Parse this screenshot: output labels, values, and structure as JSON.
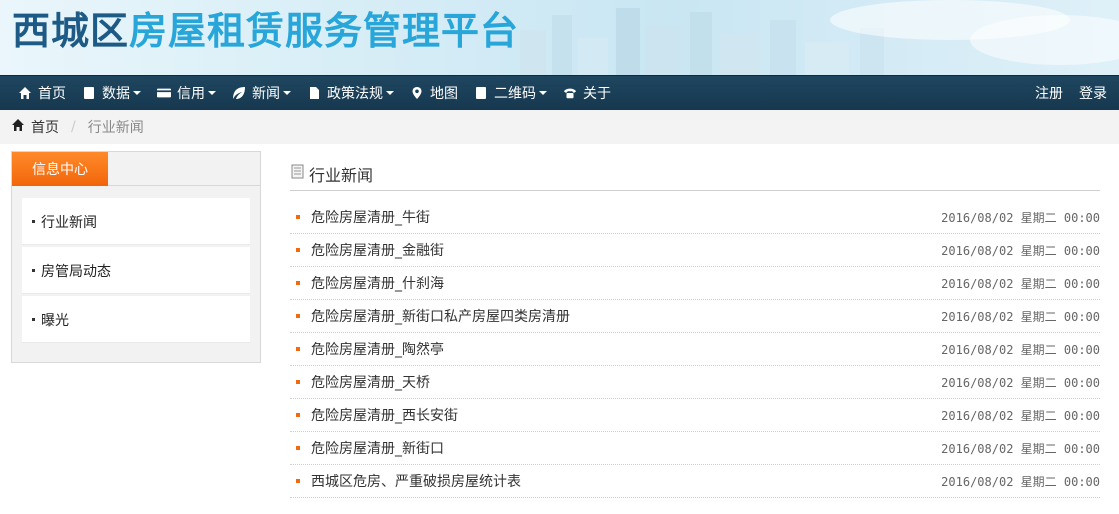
{
  "banner": {
    "title_part1": "西城区",
    "title_part2": "房屋租赁服务管理平台"
  },
  "nav": {
    "items": [
      {
        "label": "首页",
        "icon": "home-icon",
        "dropdown": false
      },
      {
        "label": "数据",
        "icon": "book-icon",
        "dropdown": true
      },
      {
        "label": "信用",
        "icon": "credit-card-icon",
        "dropdown": true
      },
      {
        "label": "新闻",
        "icon": "leaf-icon",
        "dropdown": true
      },
      {
        "label": "政策法规",
        "icon": "file-icon",
        "dropdown": true
      },
      {
        "label": "地图",
        "icon": "map-marker-icon",
        "dropdown": false
      },
      {
        "label": "二维码",
        "icon": "book-icon",
        "dropdown": true
      },
      {
        "label": "关于",
        "icon": "phone-icon",
        "dropdown": false
      }
    ],
    "register": "注册",
    "login": "登录"
  },
  "breadcrumb": {
    "home": "首页",
    "separator": "/",
    "current": "行业新闻"
  },
  "sidebar": {
    "title": "信息中心",
    "items": [
      "行业新闻",
      "房管局动态",
      "曝光"
    ]
  },
  "main": {
    "heading": "行业新闻",
    "news": [
      {
        "title": "危险房屋清册_牛街",
        "date": "2016/08/02 星期二 00:00"
      },
      {
        "title": "危险房屋清册_金融街",
        "date": "2016/08/02 星期二 00:00"
      },
      {
        "title": "危险房屋清册_什刹海",
        "date": "2016/08/02 星期二 00:00"
      },
      {
        "title": "危险房屋清册_新街口私产房屋四类房清册",
        "date": "2016/08/02 星期二 00:00"
      },
      {
        "title": "危险房屋清册_陶然亭",
        "date": "2016/08/02 星期二 00:00"
      },
      {
        "title": "危险房屋清册_天桥",
        "date": "2016/08/02 星期二 00:00"
      },
      {
        "title": "危险房屋清册_西长安街",
        "date": "2016/08/02 星期二 00:00"
      },
      {
        "title": "危险房屋清册_新街口",
        "date": "2016/08/02 星期二 00:00"
      },
      {
        "title": "西城区危房、严重破损房屋统计表",
        "date": "2016/08/02 星期二 00:00"
      }
    ]
  },
  "colors": {
    "nav_bg": "#1a3f58",
    "accent_orange": "#f2650a",
    "title_dark": "#1d5a85",
    "title_light": "#28a6d9"
  }
}
